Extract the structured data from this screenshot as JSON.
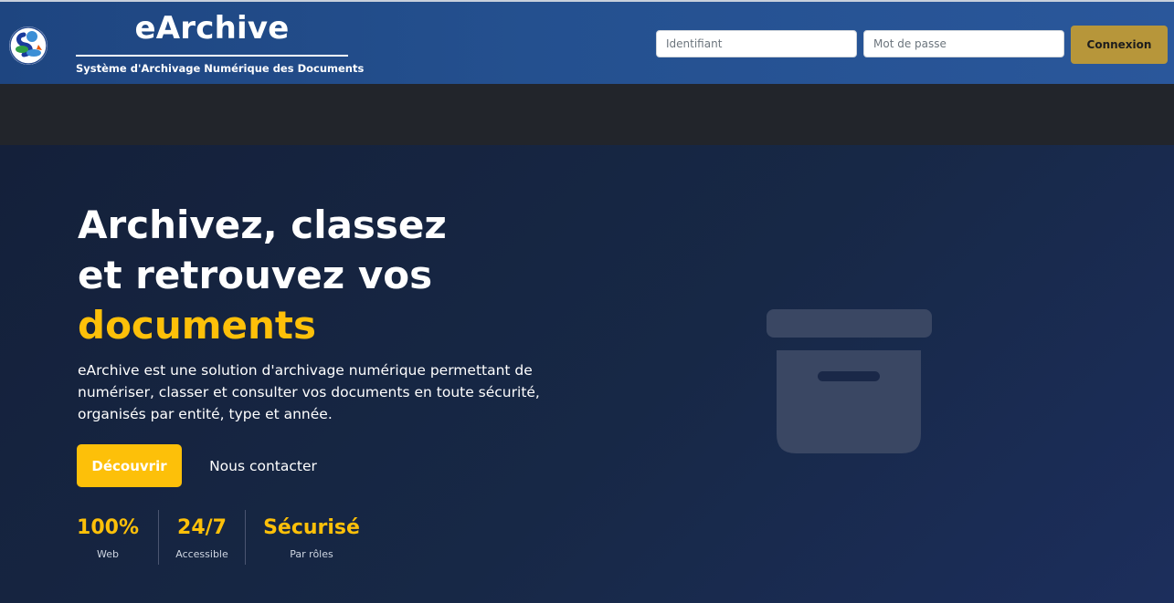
{
  "header": {
    "app_title": "eArchive",
    "app_subtitle": "Système d'Archivage Numérique des Documents",
    "logo_icon": "institution-logo-icon",
    "login": {
      "username_placeholder": "Identifiant",
      "username_value": "",
      "password_placeholder": "Mot de passe",
      "password_value": "",
      "submit_label": "Connexion"
    }
  },
  "hero": {
    "title_line1": "Archivez, classez",
    "title_line2": "et retrouvez vos",
    "title_accent": "documents",
    "description": "eArchive est une solution d'archivage numérique permettant de numériser, classer et consulter vos documents en toute sécurité, organisés par entité, type et année.",
    "primary_cta": "Découvrir",
    "secondary_cta": "Nous contacter",
    "illustration_icon": "archive-box-icon",
    "stats": [
      {
        "value": "100%",
        "label": "Web"
      },
      {
        "value": "24/7",
        "label": "Accessible"
      },
      {
        "value": "Sécurisé",
        "label": "Par rôles"
      }
    ]
  },
  "colors": {
    "header_blue": "#24508f",
    "accent_gold": "#fdc009",
    "login_button": "#b7963a",
    "band_dark": "#22252b",
    "hero_navy": "#172846"
  }
}
